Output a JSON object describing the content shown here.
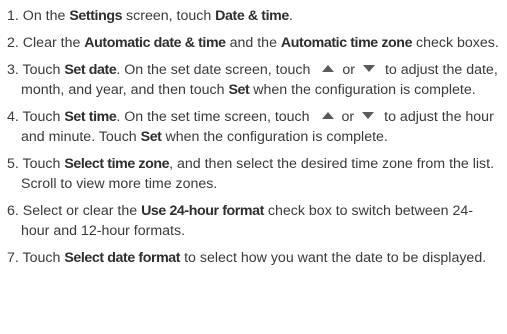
{
  "steps": [
    {
      "num": "1.",
      "t1": " On the ",
      "b1": "Settings",
      "t2": " screen, touch ",
      "b2": "Date & time",
      "t3": "."
    },
    {
      "num": "2.",
      "t1": " Clear the ",
      "b1": "Automatic date & time",
      "t2": " and the ",
      "b2": "Automatic time zone",
      "t3": " check boxes."
    },
    {
      "num": "3.",
      "t1": " Touch ",
      "b1": "Set date",
      "t2": ". On the set date screen, touch",
      "or": "or",
      "t3": "to adjust the date, month, and year, and then touch ",
      "b2": "Set",
      "t4": " when the configuration is complete."
    },
    {
      "num": "4.",
      "t1": " Touch ",
      "b1": "Set time",
      "t2": ". On the set time screen, touch",
      "or": "or",
      "t3": "to adjust the hour and minute. Touch ",
      "b2": "Set",
      "t4": " when the configuration is complete."
    },
    {
      "num": "5.",
      "t1": " Touch ",
      "b1": "Select time zone",
      "t2": ", and then select the desired time zone from the list. Scroll to view more time zones."
    },
    {
      "num": "6.",
      "t1": " Select or clear the ",
      "b1": "Use 24-hour format",
      "t2": " check box to switch between 24-hour and 12-hour formats."
    },
    {
      "num": "7.",
      "t1": " Touch ",
      "b1": "Select date format",
      "t2": " to select how you want the date to be displayed."
    }
  ],
  "icons": {
    "up": "up-arrow-icon",
    "down": "down-arrow-icon"
  }
}
